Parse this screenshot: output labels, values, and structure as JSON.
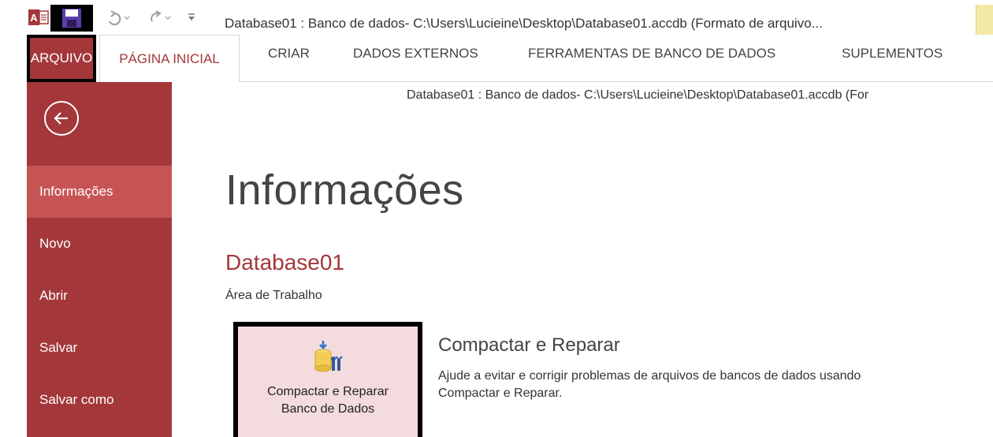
{
  "window": {
    "title": "Database01 : Banco de dados- C:\\Users\\Lucieine\\Desktop\\Database01.accdb (Formato de arquivo...",
    "icons": [
      "access-app-icon",
      "save-icon",
      "undo-icon",
      "redo-icon",
      "customize-quick-access-icon"
    ]
  },
  "ribbon": {
    "tabs": [
      {
        "label": "ARQUIVO",
        "selected": true
      },
      {
        "label": "PÁGINA INICIAL"
      },
      {
        "label": "CRIAR"
      },
      {
        "label": "DADOS EXTERNOS"
      },
      {
        "label": "FERRAMENTAS DE BANCO DE DADOS"
      },
      {
        "label": "SUPLEMENTOS"
      }
    ]
  },
  "backstage": {
    "path": "Database01 : Banco de dados- C:\\Users\\Lucieine\\Desktop\\Database01.accdb (For",
    "nav": [
      {
        "label": "Informações",
        "active": true
      },
      {
        "label": "Novo"
      },
      {
        "label": "Abrir"
      },
      {
        "label": "Salvar"
      },
      {
        "label": "Salvar como"
      }
    ],
    "page_title": "Informações",
    "db_name": "Database01",
    "db_location": "Área de Trabalho",
    "compact": {
      "button_line1": "Compactar e Reparar",
      "button_line2": "Banco de Dados",
      "heading": "Compactar e Reparar",
      "description_line1": "Ajude a evitar e corrigir problemas de arquivos de bancos de dados usando",
      "description_line2": "Compactar e Reparar."
    }
  },
  "colors": {
    "accent": "#a4373a",
    "nav_active": "#c75454",
    "button_bg": "#f4dbdd"
  }
}
